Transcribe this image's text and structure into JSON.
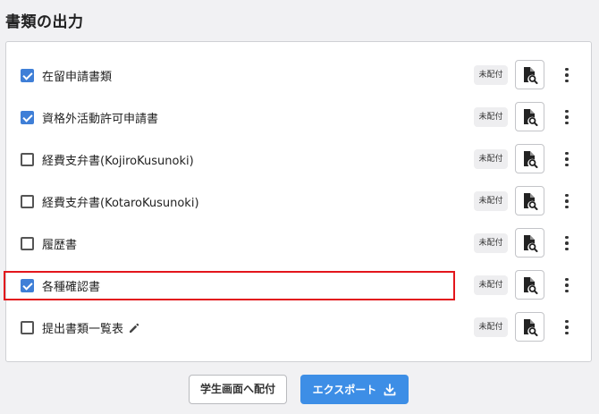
{
  "page": {
    "title": "書類の出力"
  },
  "documents": [
    {
      "label": "在留申請書類",
      "checked": true,
      "badge": "未配付"
    },
    {
      "label": "資格外活動許可申請書",
      "checked": true,
      "badge": "未配付"
    },
    {
      "label": "経費支弁書(KojiroKusunoki)",
      "checked": false,
      "badge": "未配付"
    },
    {
      "label": "経費支弁書(KotaroKusunoki)",
      "checked": false,
      "badge": "未配付"
    },
    {
      "label": "履歴書",
      "checked": false,
      "badge": "未配付"
    },
    {
      "label": "各種確認書",
      "checked": true,
      "badge": "未配付"
    },
    {
      "label": "提出書類一覧表",
      "checked": false,
      "badge": "未配付",
      "editable": true,
      "highlighted": true
    }
  ],
  "actions": {
    "deliver_label": "学生画面へ配付",
    "export_label": "エクスポート"
  },
  "colors": {
    "accent": "#3d8ee6",
    "checkbox": "#3f7fd7",
    "highlight": "#e3161c"
  },
  "icons": {
    "preview": "document-search-icon",
    "menu": "more-vertical-icon",
    "edit": "pencil-icon",
    "export": "download-icon"
  }
}
